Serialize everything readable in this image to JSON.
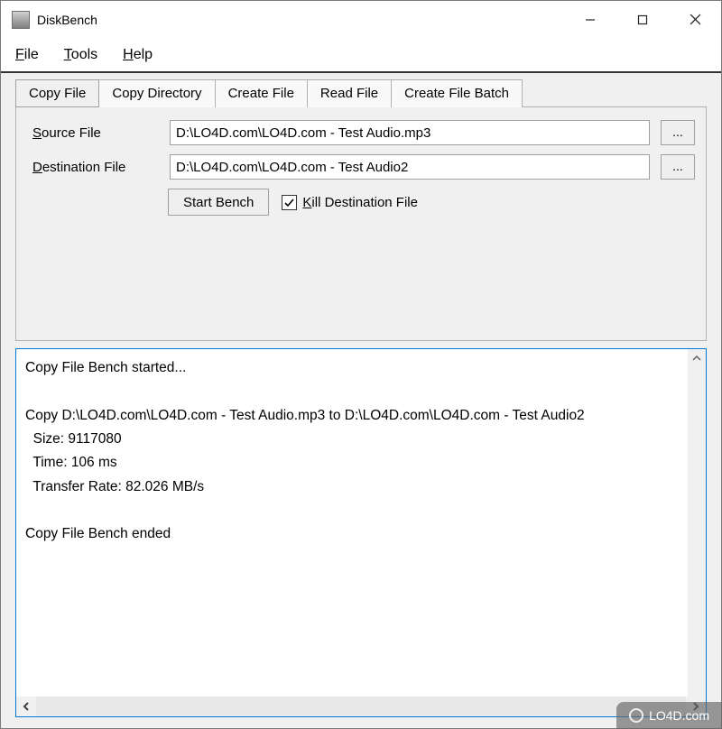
{
  "window": {
    "title": "DiskBench"
  },
  "menu": {
    "file": "File",
    "tools": "Tools",
    "help": "Help"
  },
  "tabs": {
    "copy_file": "Copy File",
    "copy_directory": "Copy Directory",
    "create_file": "Create File",
    "read_file": "Read File",
    "create_file_batch": "Create File Batch"
  },
  "form": {
    "source_label": "Source File",
    "source_value": "D:\\LO4D.com\\LO4D.com - Test Audio.mp3",
    "dest_label": "Destination File",
    "dest_value": "D:\\LO4D.com\\LO4D.com - Test Audio2",
    "browse_label": "...",
    "start_label": "Start Bench",
    "kill_label": "Kill Destination File",
    "kill_checked": true
  },
  "log": {
    "text": "Copy File Bench started...\n\nCopy D:\\LO4D.com\\LO4D.com - Test Audio.mp3 to D:\\LO4D.com\\LO4D.com - Test Audio2\n  Size: 9117080\n  Time: 106 ms\n  Transfer Rate: 82.026 MB/s\n\nCopy File Bench ended"
  },
  "watermark": {
    "text": "LO4D.com"
  }
}
